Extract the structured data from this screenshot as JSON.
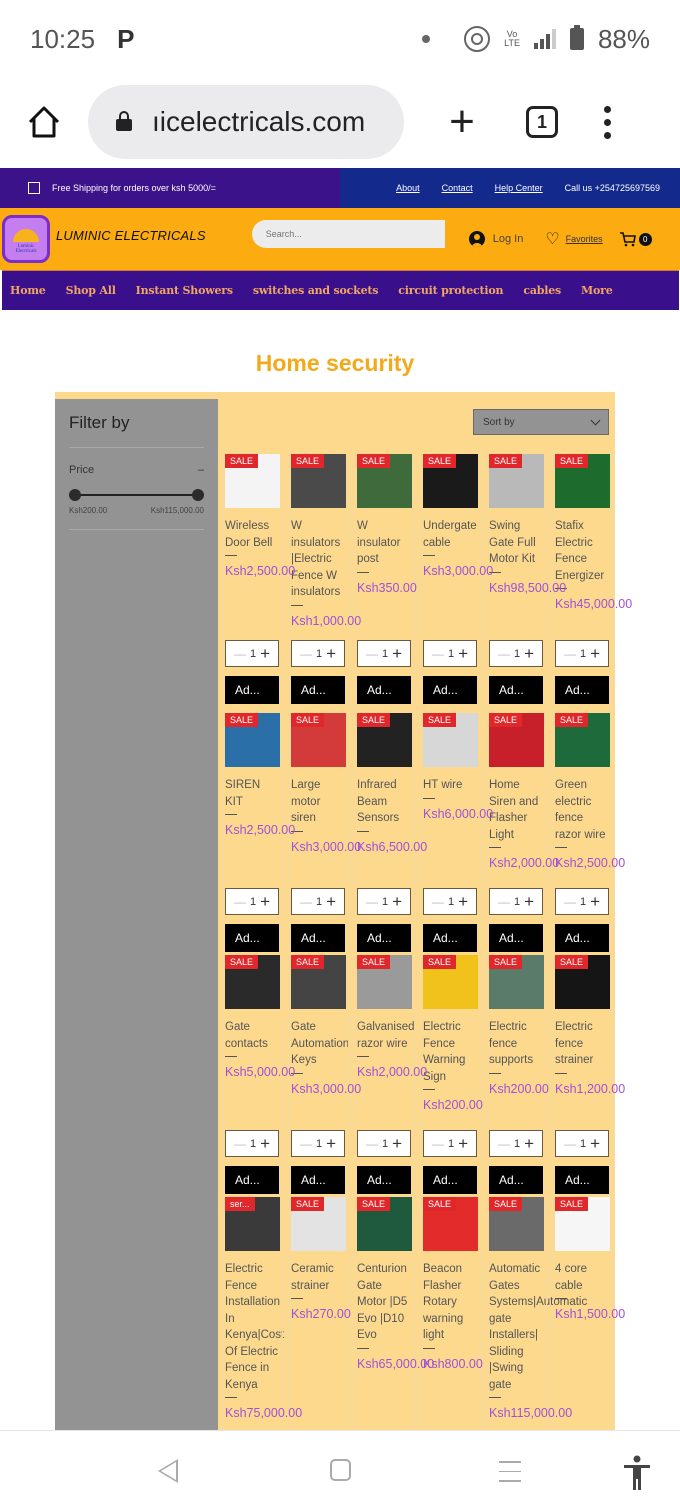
{
  "status_bar": {
    "time": "10:25",
    "app_icon": "P",
    "battery": "88%",
    "network": "LTE"
  },
  "browser": {
    "url": "ıicelectricals.com",
    "tab_count": "1"
  },
  "promo": {
    "shipping_text": "Free Shipping for orders over ksh 5000/=",
    "links": [
      "About",
      "Contact",
      "Help Center"
    ],
    "call_text": "Call us +254725697569"
  },
  "header": {
    "brand": "LUMINIC ELECTRICALS",
    "logo_text_line1": "Luminic",
    "logo_text_line2": "Electricals",
    "search_placeholder": "Search...",
    "login_label": "Log In",
    "favorites_label": "Favorites",
    "cart_count": "0"
  },
  "nav": {
    "items": [
      "Home",
      "Shop All",
      "Instant Showers",
      "switches and sockets",
      "circuit protection",
      "cables",
      "More"
    ]
  },
  "page": {
    "title": "Home security"
  },
  "filter": {
    "title": "Filter by",
    "price_label": "Price",
    "collapse_symbol": "–",
    "min_label": "Ksh200.00",
    "max_label": "Ksh115,000.00"
  },
  "sort": {
    "label": "Sort by"
  },
  "product_defaults": {
    "sale_badge": "SALE",
    "quantity": "1",
    "add_label": "Ad..."
  },
  "rows": [
    [
      {
        "name": "Wireless Door Bell",
        "price": "Ksh2,500.00",
        "badge": "SALE",
        "thumb": "#f4f4f4"
      },
      {
        "name": "W insulators |Electric Fence W insulators",
        "price": "Ksh1,000.00",
        "badge": "SALE",
        "thumb": "#4a4a4a"
      },
      {
        "name": "W insulator post",
        "price": "Ksh350.00",
        "badge": "SALE",
        "thumb": "#3f6a3c"
      },
      {
        "name": "Undergate cable",
        "price": "Ksh3,000.00",
        "badge": "SALE",
        "thumb": "#1a1a1a"
      },
      {
        "name": "Swing Gate Full Motor Kit",
        "price": "Ksh98,500.00",
        "badge": "SALE",
        "thumb": "#b9b9b9"
      },
      {
        "name": "Stafix Electric Fence Energizer",
        "price": "Ksh45,000.00",
        "badge": "SALE",
        "thumb": "#1e6b2e"
      }
    ],
    [
      {
        "name": "SIREN KIT",
        "price": "Ksh2,500.00",
        "badge": "SALE",
        "thumb": "#2a6fa8"
      },
      {
        "name": "Large motor siren",
        "price": "Ksh3,000.00",
        "badge": "SALE",
        "thumb": "#d33a3a"
      },
      {
        "name": "Infrared Beam Sensors",
        "price": "Ksh6,500.00",
        "badge": "SALE",
        "thumb": "#222222"
      },
      {
        "name": "HT wire",
        "price": "Ksh6,000.00",
        "badge": "SALE",
        "thumb": "#d7d7d7"
      },
      {
        "name": "Home Siren and Flasher Light",
        "price": "Ksh2,000.00",
        "badge": "SALE",
        "thumb": "#c8202a"
      },
      {
        "name": "Green electric fence razor wire",
        "price": "Ksh2,500.00",
        "badge": "SALE",
        "thumb": "#1f6a3a"
      }
    ],
    [
      {
        "name": "Gate contacts",
        "price": "Ksh5,000.00",
        "badge": "SALE",
        "thumb": "#2a2a2a"
      },
      {
        "name": "Gate Automation Keys",
        "price": "Ksh3,000.00",
        "badge": "SALE",
        "thumb": "#444444"
      },
      {
        "name": "Galvanised razor wire",
        "price": "Ksh2,000.00",
        "badge": "SALE",
        "thumb": "#9a9a9a"
      },
      {
        "name": "Electric Fence Warning Sign",
        "price": "Ksh200.00",
        "badge": "SALE",
        "thumb": "#f2c21c"
      },
      {
        "name": "Electric fence supports",
        "price": "Ksh200.00",
        "badge": "SALE",
        "thumb": "#5a7a6a"
      },
      {
        "name": "Electric fence strainer",
        "price": "Ksh1,200.00",
        "badge": "SALE",
        "thumb": "#151515"
      }
    ],
    [
      {
        "name": "Electric Fence Installation In Kenya|Cost Of Electric Fence in Kenya",
        "price": "Ksh75,000.00",
        "badge": "ser...",
        "thumb": "#3a3a3a"
      },
      {
        "name": "Ceramic strainer",
        "price": "Ksh270.00",
        "badge": "SALE",
        "thumb": "#e3e3e3"
      },
      {
        "name": "Centurion Gate Motor |D5 Evo |D10 Evo",
        "price": "Ksh65,000.00",
        "badge": "SALE",
        "thumb": "#1f5a3e"
      },
      {
        "name": "Beacon Flasher Rotary warning light",
        "price": "Ksh800.00",
        "badge": "SALE",
        "thumb": "#e32b2b"
      },
      {
        "name": "Automatic Gates Systems|Automatic gate Installers| Sliding |Swing gate",
        "price": "Ksh115,000.00",
        "badge": "SALE",
        "thumb": "#6a6a6a"
      },
      {
        "name": "4 core cable",
        "price": "Ksh1,500.00",
        "badge": "SALE",
        "thumb": "#f6f6f6"
      }
    ]
  ]
}
